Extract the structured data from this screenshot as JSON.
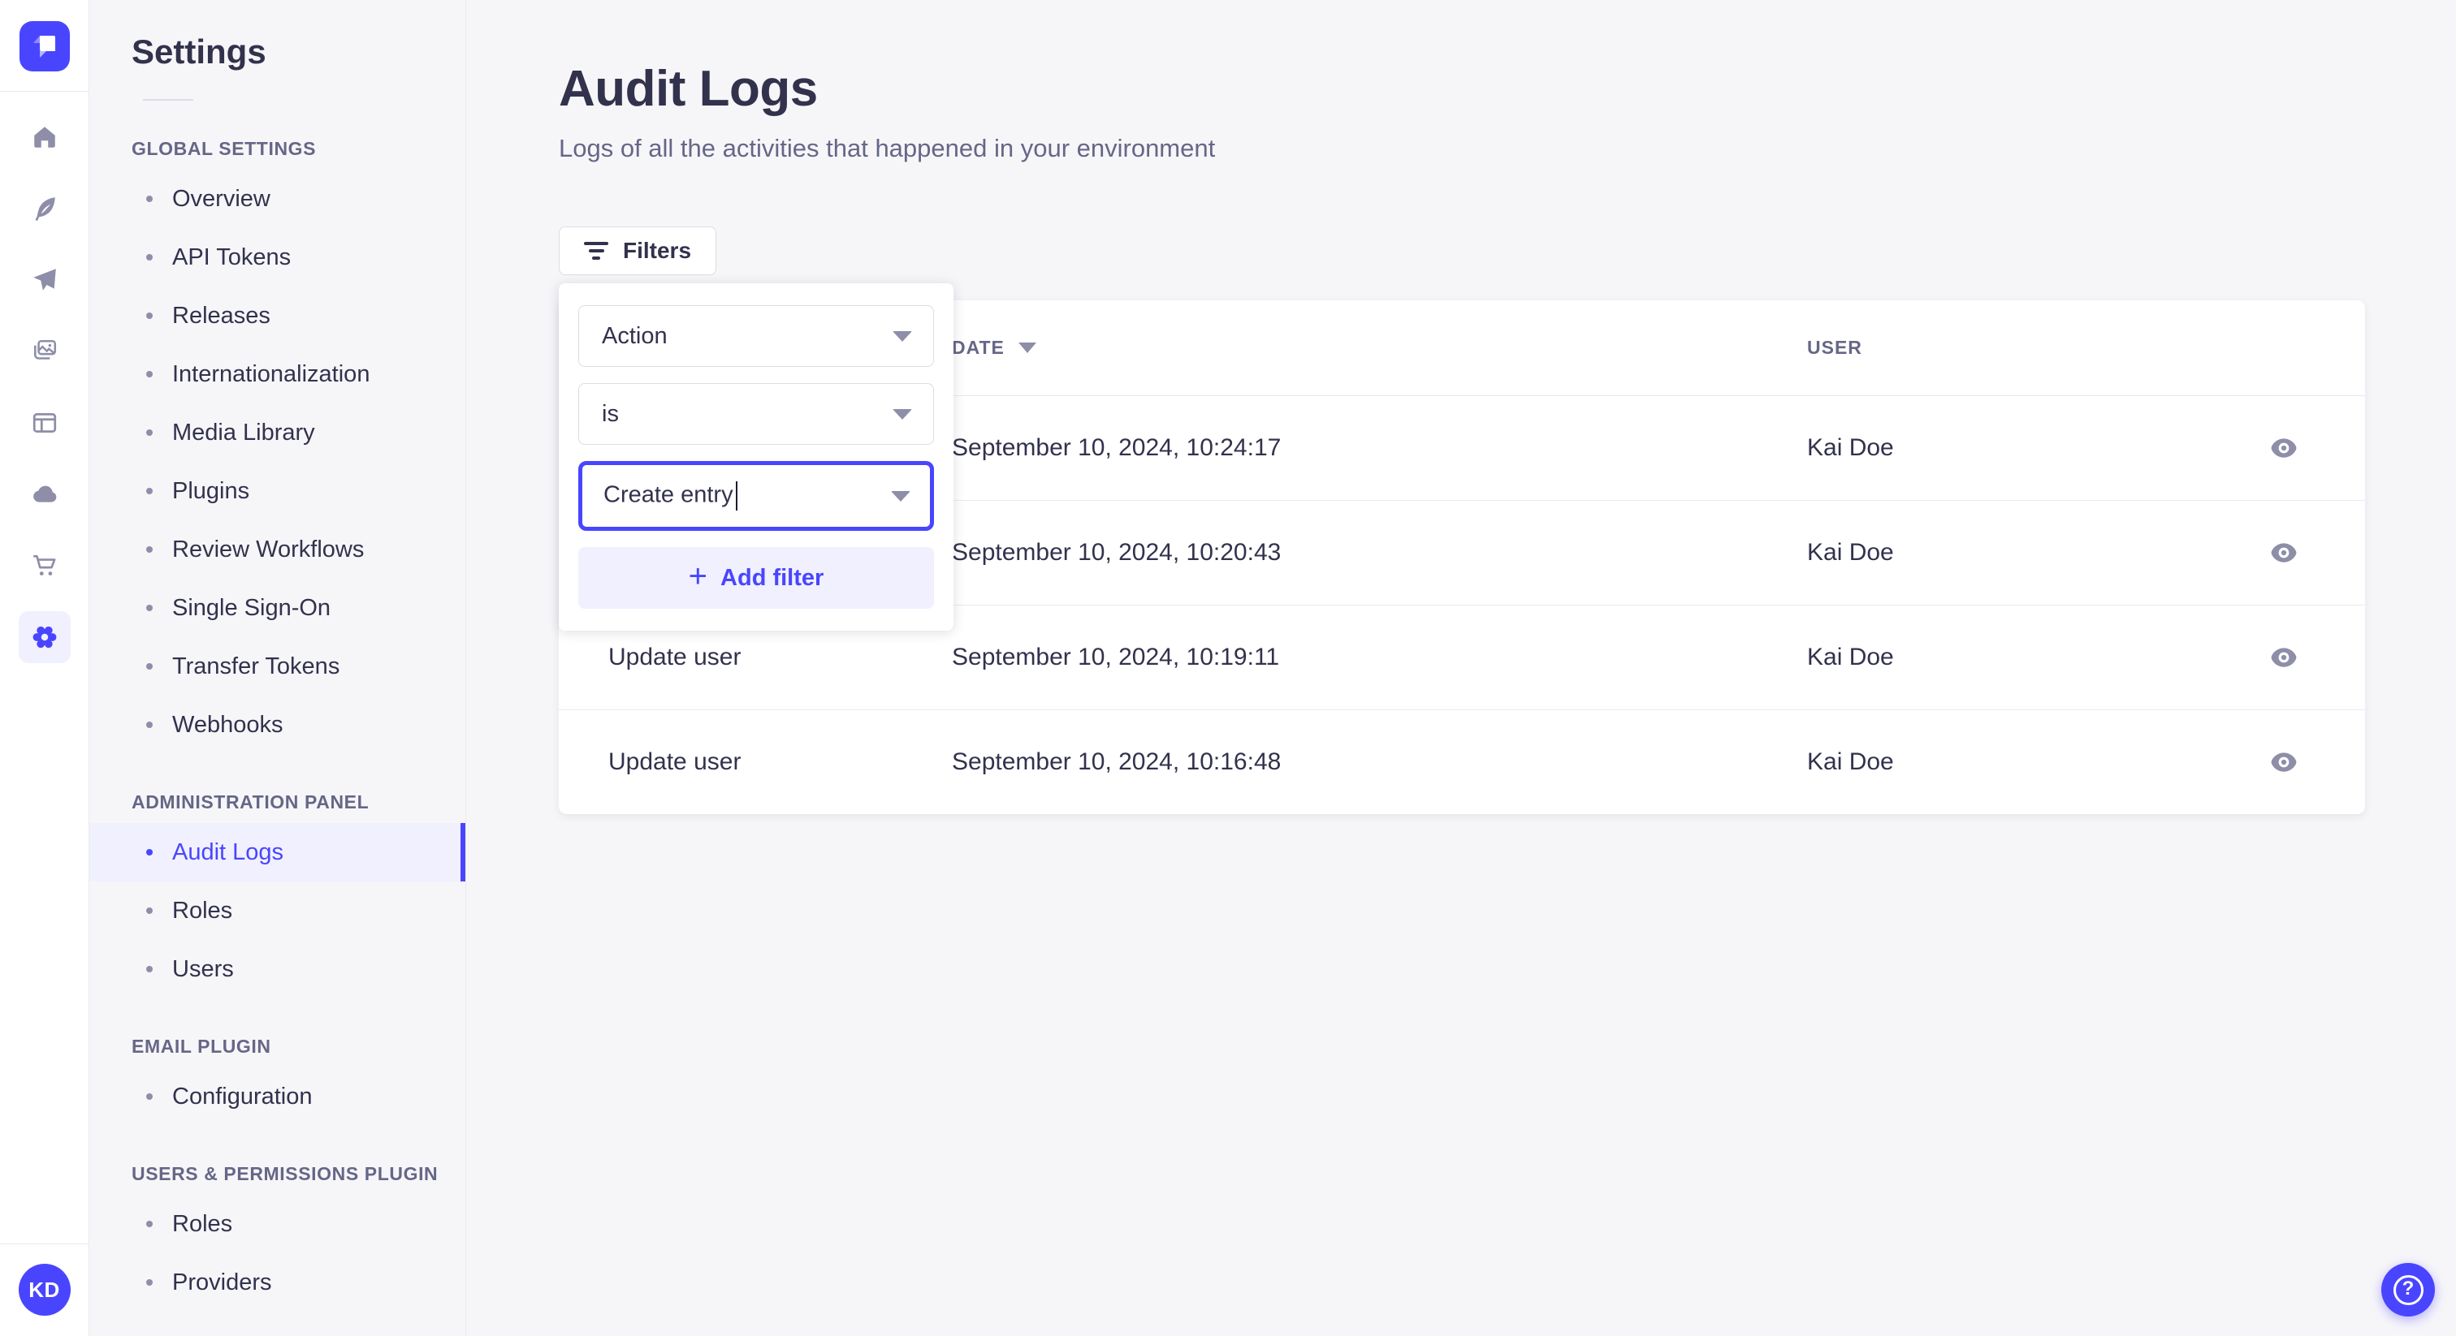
{
  "colors": {
    "primary": "#4945ff",
    "primary_light": "#f0f0ff",
    "text_dark": "#32324d",
    "text_muted": "#666687",
    "icon_gray": "#8e8ea9",
    "border": "#dcdce4",
    "divider": "#eaeaef",
    "background": "#f6f6f9"
  },
  "rail": {
    "avatar_initials": "KD"
  },
  "sidebar": {
    "title": "Settings",
    "sections": [
      {
        "label": "GLOBAL SETTINGS",
        "items": [
          {
            "label": "Overview"
          },
          {
            "label": "API Tokens"
          },
          {
            "label": "Releases"
          },
          {
            "label": "Internationalization"
          },
          {
            "label": "Media Library"
          },
          {
            "label": "Plugins"
          },
          {
            "label": "Review Workflows"
          },
          {
            "label": "Single Sign-On"
          },
          {
            "label": "Transfer Tokens"
          },
          {
            "label": "Webhooks"
          }
        ]
      },
      {
        "label": "ADMINISTRATION PANEL",
        "items": [
          {
            "label": "Audit Logs",
            "active": true
          },
          {
            "label": "Roles"
          },
          {
            "label": "Users"
          }
        ]
      },
      {
        "label": "EMAIL PLUGIN",
        "items": [
          {
            "label": "Configuration"
          }
        ]
      },
      {
        "label": "USERS & PERMISSIONS PLUGIN",
        "items": [
          {
            "label": "Roles"
          },
          {
            "label": "Providers"
          }
        ]
      }
    ]
  },
  "page": {
    "title": "Audit Logs",
    "subtitle": "Logs of all the activities that happened in your environment"
  },
  "toolbar": {
    "filters_label": "Filters"
  },
  "filter_popover": {
    "attribute_value": "Action",
    "operator_value": "is",
    "value_text": "Create entry",
    "plus_glyph": "+",
    "add_filter_label": "Add filter"
  },
  "table": {
    "headers": {
      "action": "",
      "date": "DATE",
      "user": "USER"
    },
    "rows": [
      {
        "action": "",
        "date": "September 10, 2024, 10:24:17",
        "user": "Kai Doe"
      },
      {
        "action": "",
        "date": "September 10, 2024, 10:20:43",
        "user": "Kai Doe"
      },
      {
        "action": "Update user",
        "date": "September 10, 2024, 10:19:11",
        "user": "Kai Doe"
      },
      {
        "action": "Update user",
        "date": "September 10, 2024, 10:16:48",
        "user": "Kai Doe"
      }
    ]
  },
  "help": {
    "glyph": "?"
  }
}
